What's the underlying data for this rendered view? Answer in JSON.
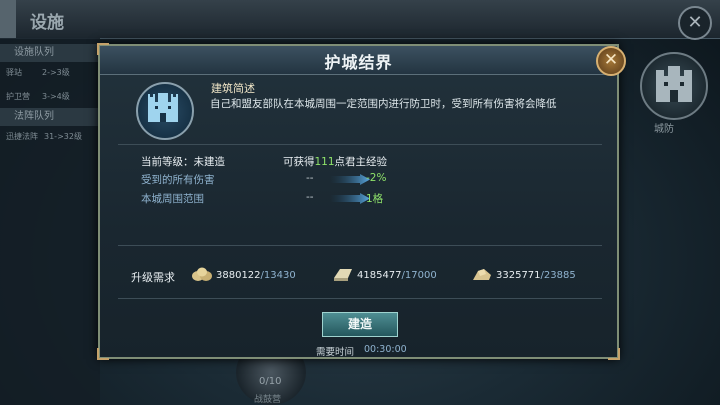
{
  "background": {
    "title": "设施",
    "left_panel": {
      "facility_queue_header": "设施队列",
      "rows": [
        {
          "name": "驿站",
          "level": "2->3级"
        },
        {
          "name": "护卫营",
          "level": "3->4级"
        }
      ],
      "formation_queue_header": "法阵队列",
      "formation_rows": [
        {
          "name": "迅捷法阵",
          "level": "31->32级"
        }
      ]
    },
    "right_building_label": "城防",
    "bottom_building": {
      "count": "0/10",
      "label": "战鼓营"
    }
  },
  "dialog": {
    "title": "护城结界",
    "close_icon": "close-x",
    "description": {
      "title": "建筑简述",
      "text": "自己和盟友部队在本城周围一定范围内进行防卫时，受到所有伤害将会降低",
      "icon": "castle-icon"
    },
    "level": {
      "label": "当前等级：未建造",
      "reward_prefix": "可获得",
      "reward_value": "111",
      "reward_suffix": "点君主经验"
    },
    "stats": [
      {
        "label": "受到的所有伤害",
        "current": "--",
        "next": "-2%"
      },
      {
        "label": "本城周围范围",
        "current": "--",
        "next": "1格"
      }
    ],
    "requirements": {
      "label": "升级需求",
      "resources": [
        {
          "icon": "grain-sacks-icon",
          "have": "3880122",
          "need": "/13430"
        },
        {
          "icon": "iron-bar-icon",
          "have": "4185477",
          "need": "/17000"
        },
        {
          "icon": "stone-icon",
          "have": "3325771",
          "need": "/23885"
        }
      ]
    },
    "build_button": "建造",
    "time_label": "需要时间",
    "time_value": "00:30:00"
  },
  "colors": {
    "accent_green": "#8fe36a",
    "accent_blue": "#8fb3cf",
    "gold_border": "#c5a26a"
  }
}
